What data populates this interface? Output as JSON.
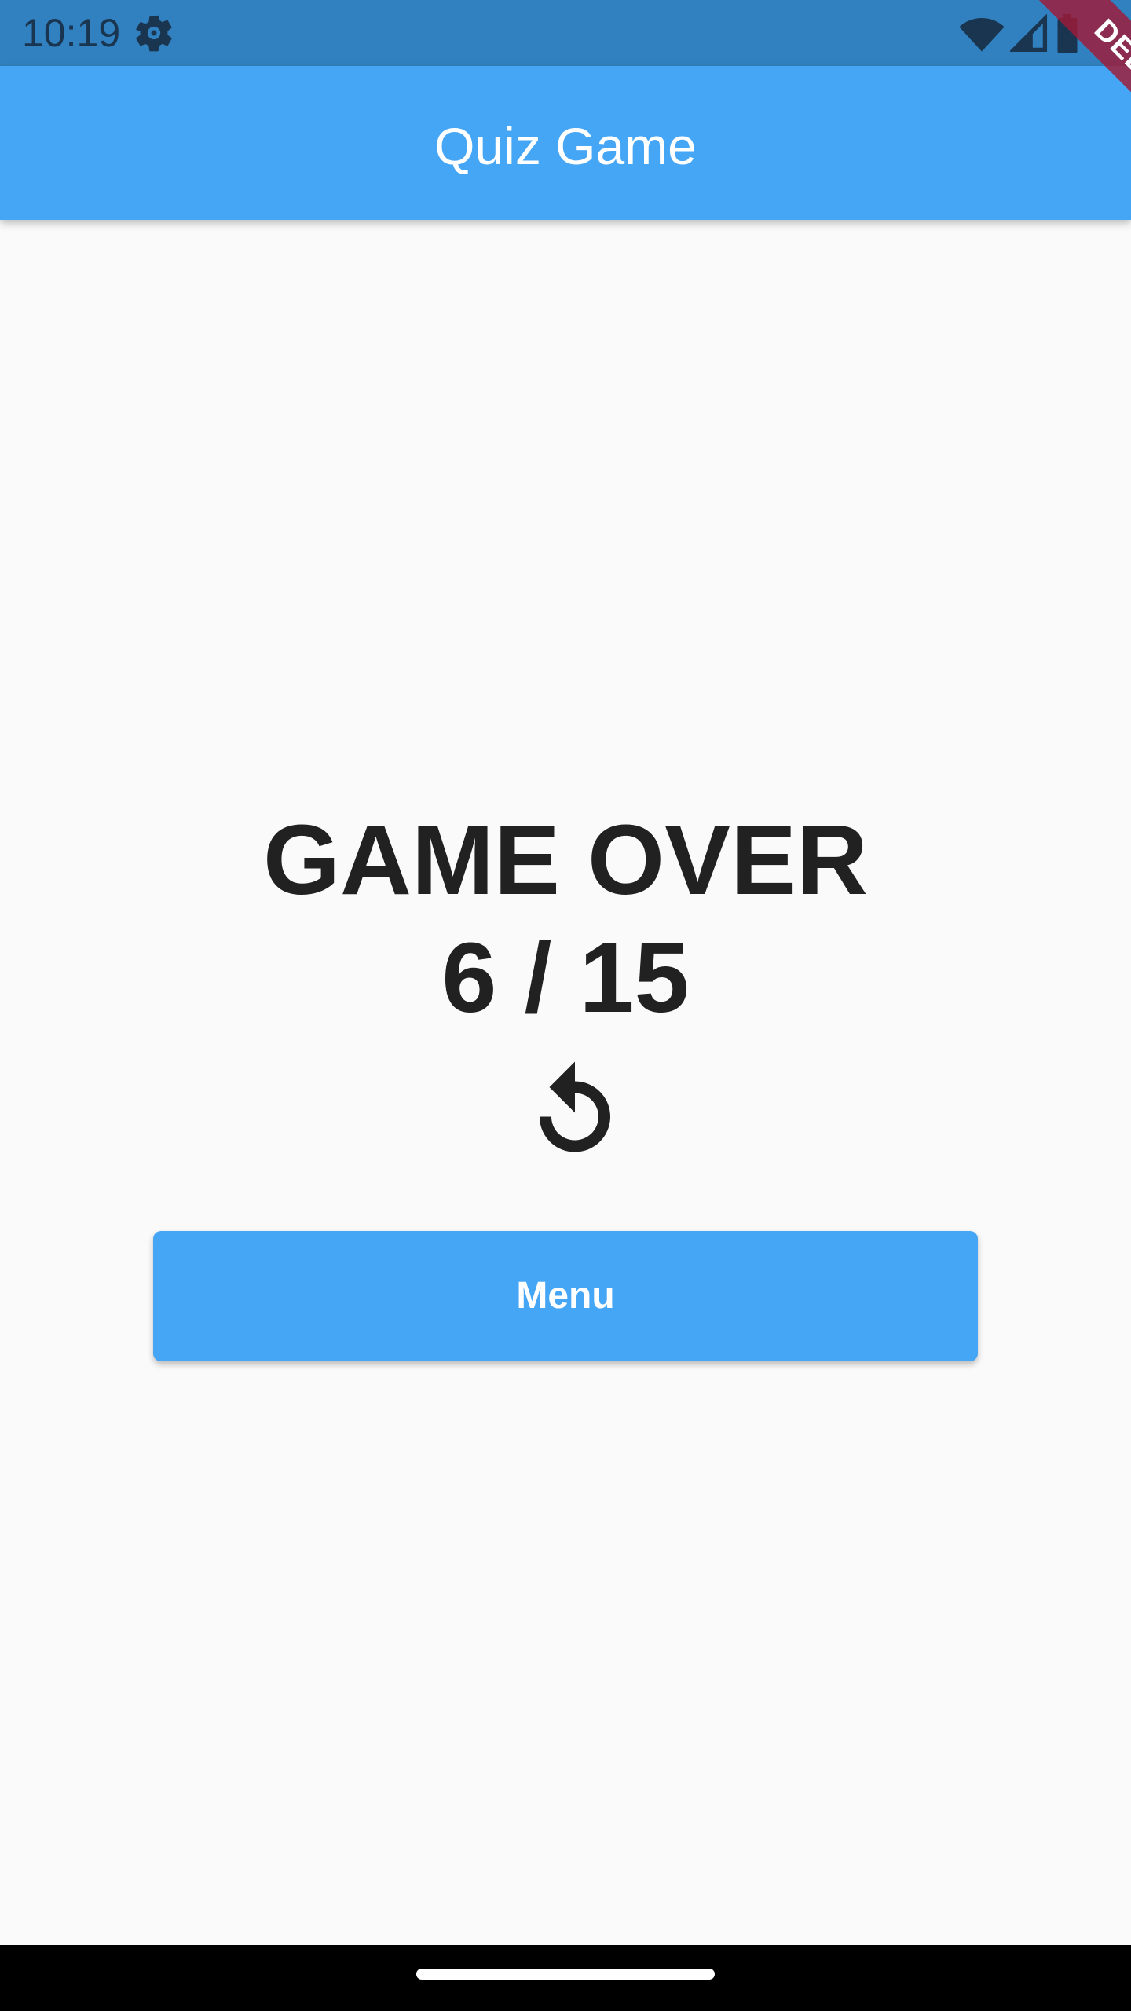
{
  "status_bar": {
    "time": "10:19",
    "icons": [
      "gear-icon",
      "wifi-icon",
      "signal-icon",
      "battery-icon"
    ]
  },
  "app_bar": {
    "title": "Quiz Game"
  },
  "debug_banner": {
    "label": "DEBUG"
  },
  "result": {
    "title": "GAME OVER",
    "score": "6 / 15"
  },
  "replay": {
    "icon": "replay-icon"
  },
  "menu_button": {
    "label": "Menu"
  },
  "colors": {
    "accent": "#45a6f5",
    "status_bar": "#3180bf",
    "background": "#fafafa",
    "text": "#212121",
    "debug": "#a01a37"
  }
}
